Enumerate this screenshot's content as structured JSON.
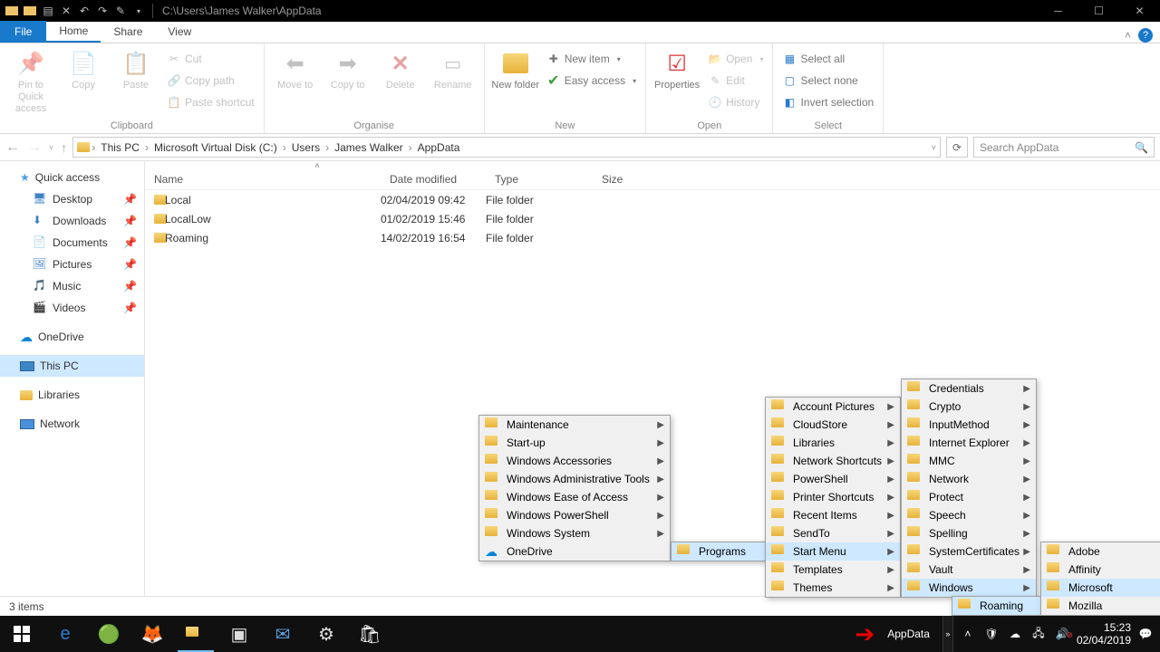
{
  "titlebar": {
    "path": "C:\\Users\\James Walker\\AppData"
  },
  "tabs": {
    "file": "File",
    "items": [
      "Home",
      "Share",
      "View"
    ],
    "activeIndex": 0
  },
  "ribbon": {
    "clipboard": {
      "label": "Clipboard",
      "pin": "Pin to Quick access",
      "copy": "Copy",
      "paste": "Paste",
      "cut": "Cut",
      "copy_path": "Copy path",
      "paste_shortcut": "Paste shortcut"
    },
    "organise": {
      "label": "Organise",
      "move": "Move to",
      "copy": "Copy to",
      "delete": "Delete",
      "rename": "Rename"
    },
    "new": {
      "label": "New",
      "new_folder": "New folder",
      "new_item": "New item",
      "easy_access": "Easy access"
    },
    "open": {
      "label": "Open",
      "properties": "Properties",
      "open": "Open",
      "edit": "Edit",
      "history": "History"
    },
    "select": {
      "label": "Select",
      "all": "Select all",
      "none": "Select none",
      "invert": "Invert selection"
    }
  },
  "breadcrumb": [
    "This PC",
    "Microsoft Virtual Disk (C:)",
    "Users",
    "James Walker",
    "AppData"
  ],
  "search": {
    "placeholder": "Search AppData"
  },
  "nav": {
    "quick_access": "Quick access",
    "pinned": [
      "Desktop",
      "Downloads",
      "Documents",
      "Pictures",
      "Music",
      "Videos"
    ],
    "onedrive": "OneDrive",
    "this_pc": "This PC",
    "libraries": "Libraries",
    "network": "Network"
  },
  "cols": {
    "name": "Name",
    "date": "Date modified",
    "type": "Type",
    "size": "Size"
  },
  "rows": [
    {
      "name": "Local",
      "date": "02/04/2019 09:42",
      "type": "File folder"
    },
    {
      "name": "LocalLow",
      "date": "01/02/2019 15:46",
      "type": "File folder"
    },
    {
      "name": "Roaming",
      "date": "14/02/2019 16:54",
      "type": "File folder"
    }
  ],
  "status": {
    "count": "3 items"
  },
  "menus": {
    "m1": [
      {
        "l": "Maintenance",
        "a": true
      },
      {
        "l": "Start-up",
        "a": true
      },
      {
        "l": "Windows Accessories",
        "a": true
      },
      {
        "l": "Windows Administrative Tools",
        "a": true
      },
      {
        "l": "Windows Ease of Access",
        "a": true
      },
      {
        "l": "Windows PowerShell",
        "a": true
      },
      {
        "l": "Windows System",
        "a": true
      },
      {
        "l": "OneDrive",
        "od": true
      }
    ],
    "m1_slot": "Programs",
    "m2": [
      {
        "l": "Account Pictures",
        "a": true
      },
      {
        "l": "CloudStore",
        "a": true
      },
      {
        "l": "Libraries",
        "a": true
      },
      {
        "l": "Network Shortcuts",
        "a": true
      },
      {
        "l": "PowerShell",
        "a": true
      },
      {
        "l": "Printer Shortcuts",
        "a": true
      },
      {
        "l": "Recent Items",
        "a": true
      },
      {
        "l": "SendTo",
        "a": true
      },
      {
        "l": "Start Menu",
        "a": true,
        "h": true
      },
      {
        "l": "Templates",
        "a": true
      },
      {
        "l": "Themes",
        "a": true
      }
    ],
    "m3": [
      {
        "l": "Credentials",
        "a": true
      },
      {
        "l": "Crypto",
        "a": true
      },
      {
        "l": "InputMethod",
        "a": true
      },
      {
        "l": "Internet Explorer",
        "a": true
      },
      {
        "l": "MMC",
        "a": true
      },
      {
        "l": "Network",
        "a": true
      },
      {
        "l": "Protect",
        "a": true
      },
      {
        "l": "Speech",
        "a": true
      },
      {
        "l": "Spelling",
        "a": true
      },
      {
        "l": "SystemCertificates",
        "a": true
      },
      {
        "l": "Vault",
        "a": true
      },
      {
        "l": "Windows",
        "a": true,
        "h": true
      }
    ],
    "m3_slot": "Roaming",
    "m4": [
      {
        "l": "Adobe",
        "a": true
      },
      {
        "l": "Affinity",
        "a": true
      },
      {
        "l": "Microsoft",
        "a": true,
        "h": true
      },
      {
        "l": "Mozilla",
        "a": true
      }
    ]
  },
  "taskbar": {
    "toolbar_label": "AppData",
    "clock": {
      "time": "15:23",
      "date": "02/04/2019"
    }
  }
}
